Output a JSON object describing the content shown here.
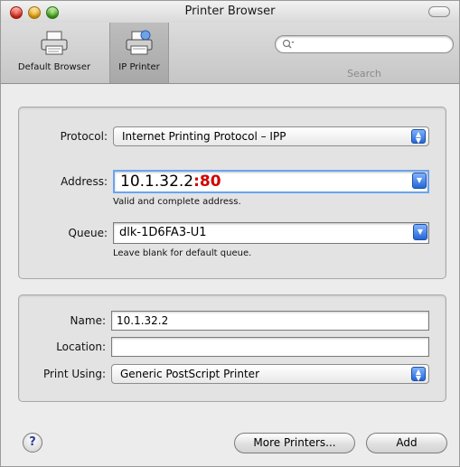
{
  "window": {
    "title": "Printer Browser"
  },
  "toolbar": {
    "default_browser_label": "Default Browser",
    "ip_printer_label": "IP Printer",
    "search_placeholder": "",
    "search_label": "Search"
  },
  "ip_settings": {
    "protocol_label": "Protocol:",
    "protocol_value": "Internet Printing Protocol – IPP",
    "address_label": "Address:",
    "address_host": "10.1.32.2",
    "address_port": ":80",
    "address_hint": "Valid and complete address.",
    "queue_label": "Queue:",
    "queue_value": "dlk-1D6FA3-U1",
    "queue_hint": "Leave blank for default queue."
  },
  "printer_info": {
    "name_label": "Name:",
    "name_value": "10.1.32.2",
    "location_label": "Location:",
    "location_value": "",
    "print_using_label": "Print Using:",
    "print_using_value": "Generic PostScript Printer"
  },
  "footer": {
    "help_label": "?",
    "more_printers_label": "More Printers...",
    "add_label": "Add"
  },
  "colors": {
    "port_highlight": "#d10000",
    "accent_blue": "#2466d8"
  }
}
